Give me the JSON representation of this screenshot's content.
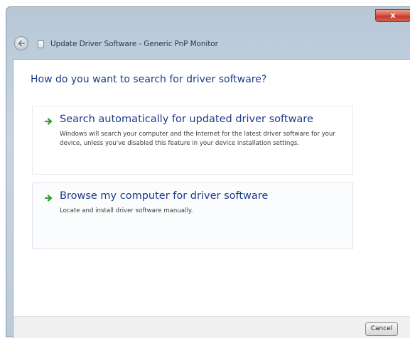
{
  "window": {
    "title": "Update Driver Software - Generic PnP Monitor",
    "close_glyph": "x",
    "icons": {
      "back": "back-arrow-icon",
      "title": "driver-device-icon",
      "close": "close-icon"
    }
  },
  "main": {
    "heading": "How do you want to search for driver software?",
    "options": [
      {
        "title": "Search automatically for updated driver software",
        "description": "Windows will search your computer and the Internet for the latest driver software for your device, unless you've disabled this feature in your device installation settings.",
        "icon": "green-arrow-icon"
      },
      {
        "title": "Browse my computer for driver software",
        "description": "Locate and install driver software manually.",
        "icon": "green-arrow-icon"
      }
    ]
  },
  "footer": {
    "cancel_label": "Cancel"
  },
  "colors": {
    "link_blue": "#1e3b8a",
    "arrow_green": "#2f9e2f",
    "close_red": "#c6392b"
  }
}
